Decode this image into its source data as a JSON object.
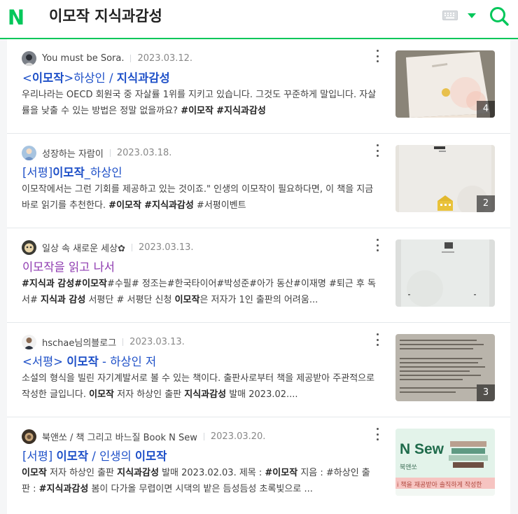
{
  "header": {
    "logo": "N",
    "query": "이모작 지식과감성"
  },
  "colors": {
    "brand": "#03c75a",
    "link": "#1e50c8",
    "visited": "#8e3ab0"
  },
  "icons": [
    "keyboard-icon",
    "dropdown-caret-icon",
    "search-icon",
    "more-icon"
  ],
  "results": [
    {
      "author": "You must be Sora.",
      "date": "2023.03.12.",
      "title_parts": [
        "<",
        "이모작",
        ">하상인 / ",
        "지식과감성"
      ],
      "desc_parts": [
        "우리나라는 OECD 회원국 중 자살률 1위를 지키고 있습니다. 그것도 꾸준하게 말입니다. 자살률을 낮출 수 있는 방법은 정말 없을까요? ",
        "#이모작",
        " ",
        "#지식과감성"
      ],
      "count": "4"
    },
    {
      "author": "성장하는 자람이",
      "date": "2023.03.18.",
      "title_parts": [
        "[서평]",
        "이모작",
        "_하상인"
      ],
      "desc_parts": [
        "이모작에서는 그런 기회를 제공하고 있는 것이죠.\" 인생의 이모작이 필요하다면, 이 책을 지금 바로 읽기를 추천한다. ",
        "#이모작",
        " ",
        "#지식과감성",
        " #서평이벤트"
      ],
      "count": "2"
    },
    {
      "author": "일상 속 새로운 세상✿",
      "date": "2023.03.13.",
      "title_parts": [
        "이모작을 읽고 나서"
      ],
      "desc_parts": [
        "#지식과 감성",
        "",
        "#이모작",
        "#수필# 정조는#한국타이어#박성준#아가 동산#이재명 #퇴근 후 독서# ",
        "지식과 감성",
        " 서평단 # 서평단 신청 ",
        "이모작",
        "은 저자가 1인 출판의 어려움..."
      ],
      "count": ""
    },
    {
      "author": "hschae님의블로그",
      "date": "2023.03.13.",
      "title_parts": [
        "<서평> ",
        "이모작",
        " - 하상인 저"
      ],
      "desc_parts": [
        "소설의 형식을 빌린 자기계발서로 볼 수 있는 책이다. 출판사로부터 책을 제공받아 주관적으로 작성한 글입니다. ",
        "이모작",
        " 저자 하상인 출판 ",
        "지식과감성",
        " 발매 2023.02...."
      ],
      "count": "3"
    },
    {
      "author": "북앤쏘 / 책 그리고 바느질 Book N Sew",
      "date": "2023.03.20.",
      "title_parts": [
        "[서평] ",
        "이모작",
        " / 인생의 ",
        "이모작"
      ],
      "desc_parts": [
        "이모작",
        " 저자 하상인 출판 ",
        "지식과감성",
        " 발매 2023.02.03. 제목 : ",
        "#이모작",
        " 지음 : #하상인 출판 : ",
        "#지식과감성",
        " 봄이 다가올 무렵이면 시댁의 밭은 듬성듬성 초록빛으로 ..."
      ],
      "count": "",
      "thumb_text": "N Sew",
      "thumb_sub": "북앤쏘",
      "thumb_band": "i 책을 재공받아 솔직하게 작성한"
    }
  ]
}
